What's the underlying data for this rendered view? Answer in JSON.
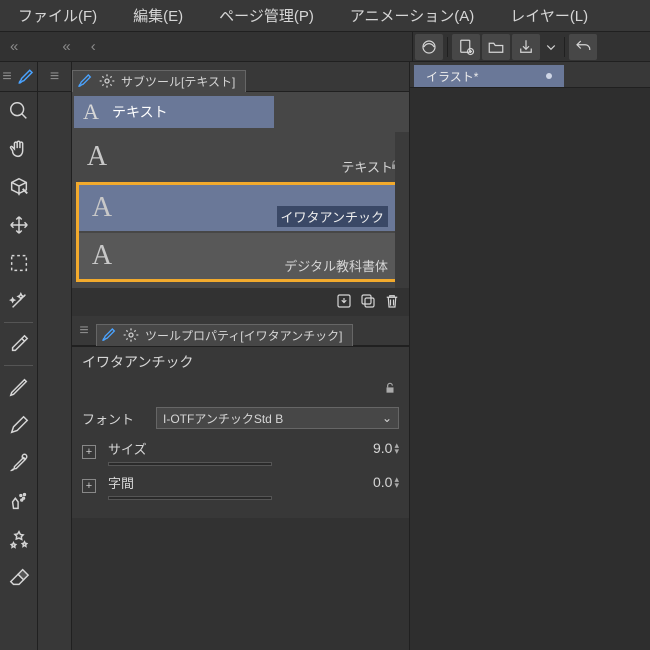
{
  "menubar": {
    "file": "ファイル(F)",
    "edit": "編集(E)",
    "page": "ページ管理(P)",
    "anim": "アニメーション(A)",
    "layer": "レイヤー(L)"
  },
  "subtool_panel": {
    "title": "サブツール[テキスト]",
    "group_label": "テキスト",
    "items": [
      {
        "label": "テキスト",
        "locked": true
      },
      {
        "label": "イワタアンチック",
        "selected": true
      },
      {
        "label": "デジタル教科書体"
      }
    ]
  },
  "tool_property": {
    "title": "ツールプロパティ[イワタアンチック]",
    "name": "イワタアンチック",
    "font_label": "フォント",
    "font_value": "I-OTFアンチックStd B",
    "size_label": "サイズ",
    "size_value": "9.0",
    "kerning_label": "字間",
    "kerning_value": "0.0"
  },
  "document_tab": {
    "title": "イラスト*"
  },
  "glyphs": {
    "angle2": "«",
    "angle1": "‹"
  }
}
